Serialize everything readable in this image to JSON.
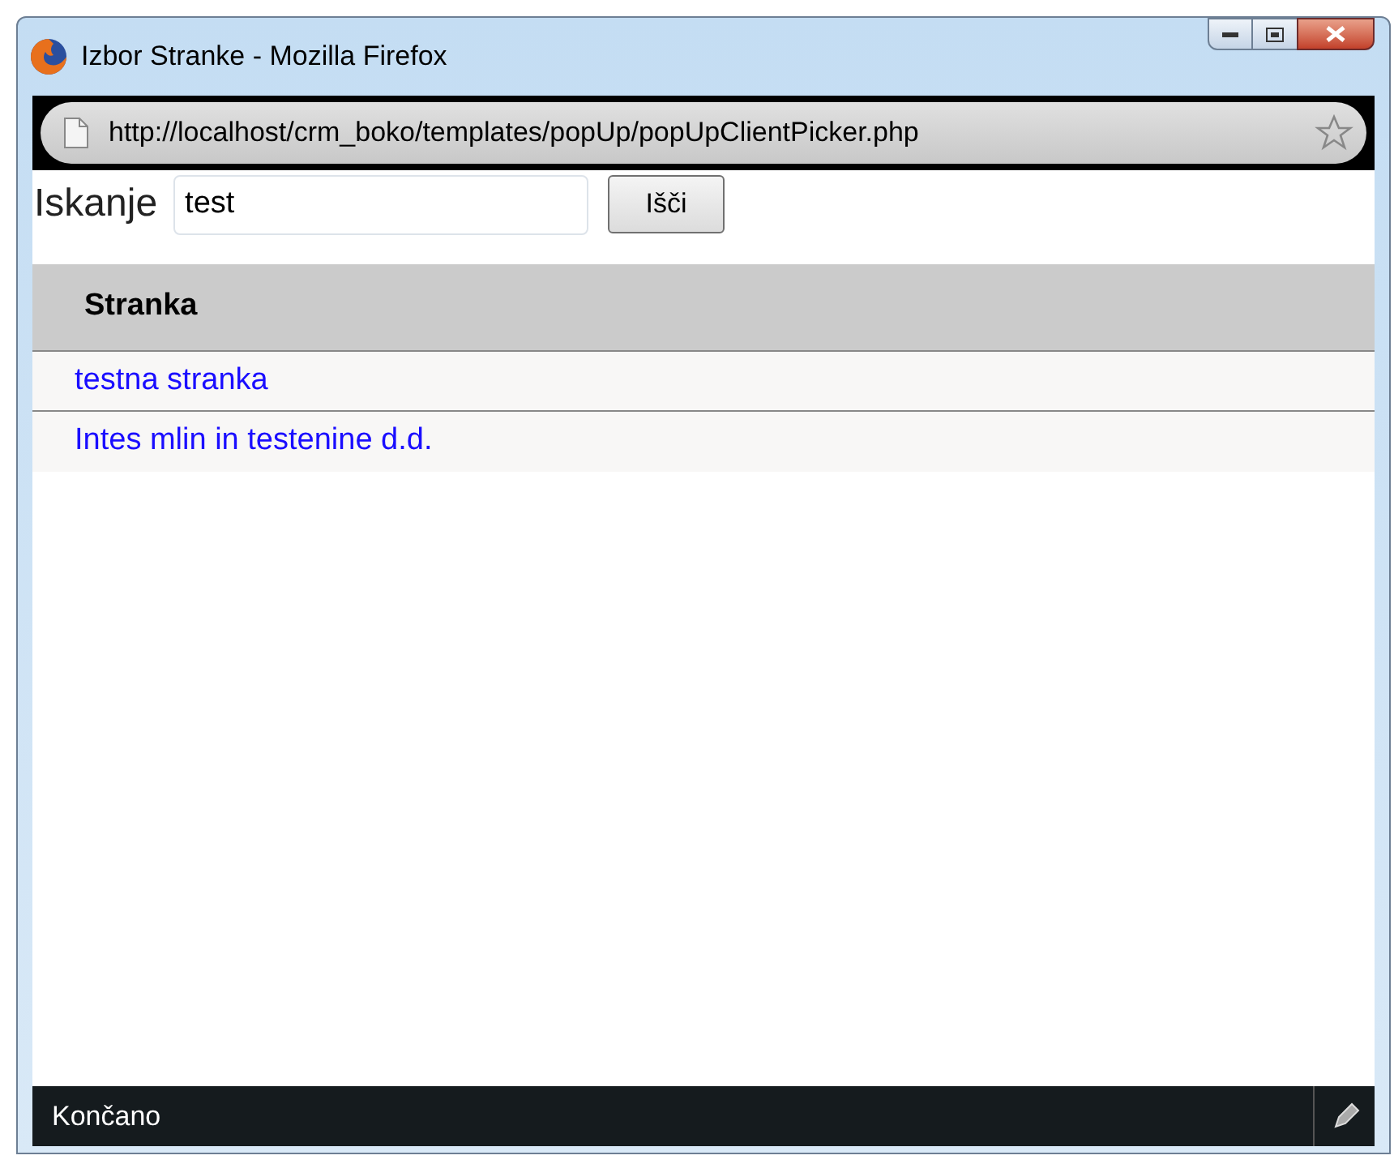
{
  "window": {
    "title": "Izbor Stranke - Mozilla Firefox"
  },
  "address_bar": {
    "url": "http://localhost/crm_boko/templates/popUp/popUpClientPicker.php"
  },
  "search": {
    "label": "Iskanje",
    "value": "test",
    "button": "Išči"
  },
  "table": {
    "columns": [
      "Stranka"
    ],
    "rows": [
      {
        "name": "testna stranka"
      },
      {
        "name": "Intes mlin in testenine d.d."
      }
    ]
  },
  "status_bar": {
    "text": "Končano"
  }
}
